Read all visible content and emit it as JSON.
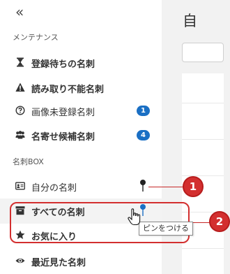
{
  "collapse_glyph": "«",
  "sections": {
    "maintenance": "メンテナンス",
    "box": "名刺BOX"
  },
  "maintenance_items": [
    {
      "label": "登録待ちの名刺",
      "icon": "hourglass-icon"
    },
    {
      "label": "読み取り不能名刺",
      "icon": "warning-icon"
    },
    {
      "label": "画像未登録名刺",
      "icon": "question-circle-icon",
      "badge": "1"
    },
    {
      "label": "名寄せ候補名刺",
      "icon": "users-icon",
      "badge": "4"
    }
  ],
  "box_items": [
    {
      "label": "自分の名刺",
      "icon": "id-card-icon"
    },
    {
      "label": "すべての名刺",
      "icon": "archive-icon"
    },
    {
      "label": "お気に入り",
      "icon": "star-icon"
    },
    {
      "label": "最近見た名刺",
      "icon": "eye-icon"
    }
  ],
  "tooltip": "ピンをつける",
  "callouts": [
    "1",
    "2"
  ],
  "main_title": "自",
  "colors": {
    "badge": "#1a6fc4",
    "pin_active": "#1a6fc4",
    "pin_inactive": "#222222",
    "callout": "#d32f2f"
  }
}
